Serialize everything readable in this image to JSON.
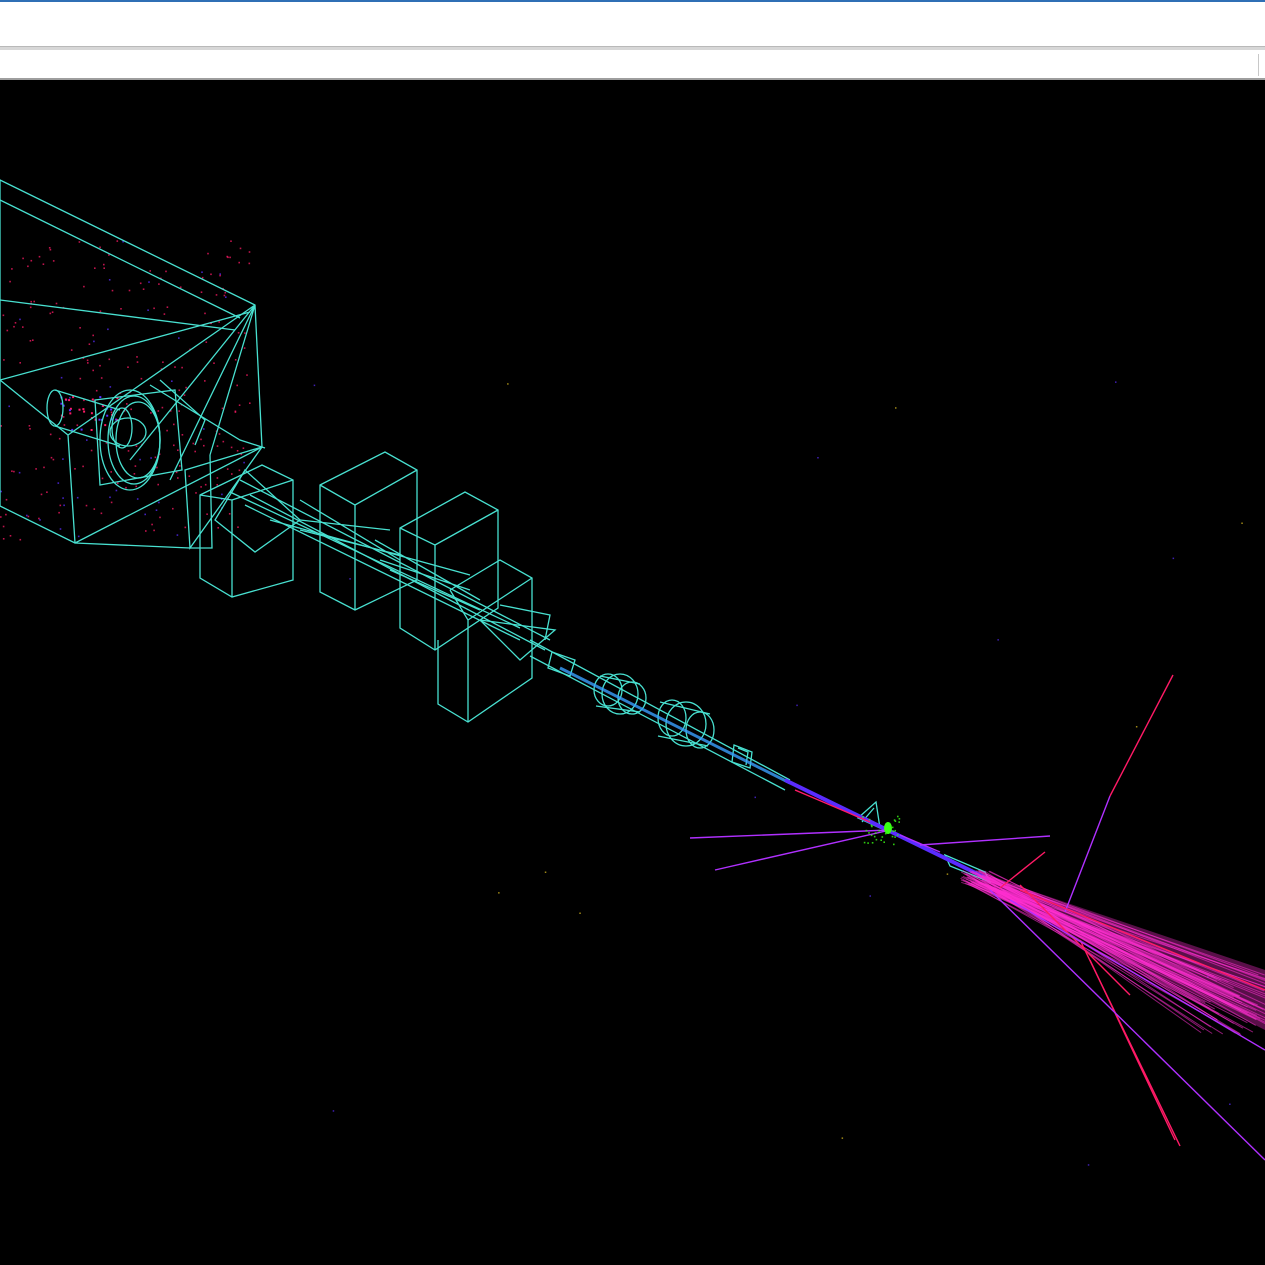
{
  "window": {
    "accent_color": "#2f6fb5"
  },
  "colors": {
    "background": "#000000",
    "geometry": "#48e0d0",
    "beam_track": "#5a2cff",
    "forward_jet": "#ff2fd0",
    "charged_track": "#ff1a66",
    "soft_track": "#b030ff",
    "vertex_hits": "#39ff14",
    "neutral_hit": "#e0c020"
  }
}
